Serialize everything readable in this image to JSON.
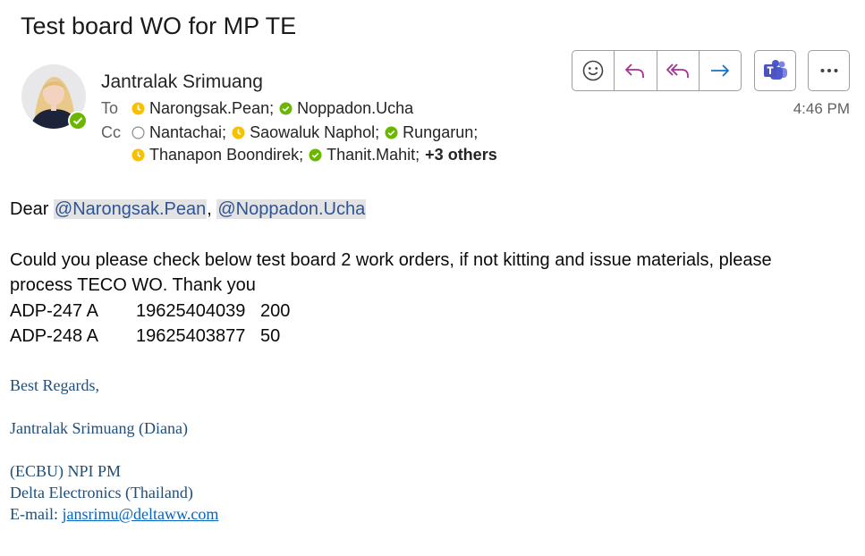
{
  "email": {
    "subject": "Test board WO for MP TE",
    "sender": "Jantralak Srimuang",
    "time": "4:46 PM",
    "to_label": "To",
    "cc_label": "Cc",
    "to": [
      {
        "name": "Narongsak.Pean;",
        "status": "away"
      },
      {
        "name": "Noppadon.Ucha",
        "status": "available"
      }
    ],
    "cc_line1": [
      {
        "name": "Nantachai;",
        "status": "offline"
      },
      {
        "name": "Saowaluk Naphol;",
        "status": "away"
      },
      {
        "name": "Rungarun;",
        "status": "available"
      }
    ],
    "cc_line2": [
      {
        "name": "Thanapon Boondirek;",
        "status": "away"
      },
      {
        "name": "Thanit.Mahit;",
        "status": "available"
      }
    ],
    "more_label": "+3 others"
  },
  "colors": {
    "available": "#6bb700",
    "away": "#f8c100",
    "offline": "#8a8a8a",
    "mention_bg": "#e3e3e3",
    "mention_text": "#2f5496",
    "signature": "#1f4e79"
  },
  "icons": [
    "emoji-icon",
    "reply-icon",
    "reply-all-icon",
    "forward-icon",
    "teams-icon",
    "more-icon"
  ],
  "body": {
    "greeting": "Dear",
    "mention1": "@Narongsak.Pean",
    "comma": ",",
    "mention2": "@Noppadon.Ucha",
    "line1": "Could you please check below test board 2 work orders, if not kitting and issue materials, please",
    "line2": "process TECO WO. Thank you",
    "orders": [
      {
        "model": "ADP-247 A",
        "wo": "19625404039",
        "qty": "200"
      },
      {
        "model": "ADP-248 A",
        "wo": "19625403877",
        "qty": "50"
      }
    ]
  },
  "signature": {
    "regards": "Best Regards,",
    "name": "Jantralak Srimuang (Diana)",
    "title": "(ECBU) NPI PM",
    "company": "Delta Electronics (Thailand)",
    "email_label": "E-mail:",
    "email": "jansrimu@deltaww.com"
  }
}
